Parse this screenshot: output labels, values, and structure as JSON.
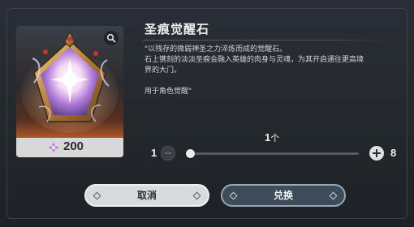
{
  "item": {
    "name": "圣痕觉醒石",
    "description": [
      "\"以残存的微弱神圣之力淬炼而成的觉醒石。",
      "石上镌刻的淡淡圣痕会融入英雄的肉身与灵魂，为其开启通往更高境",
      "界的大门。",
      "",
      "用于角色觉醒\""
    ],
    "price": "200",
    "price_icon": "purple-crystal-icon"
  },
  "quantity": {
    "current": "1",
    "unit": "个",
    "min": "1",
    "max": "8",
    "slider_fraction": 0
  },
  "buttons": {
    "cancel": "取消",
    "confirm": "兑换"
  },
  "colors": {
    "confirm_button": "#3c4c5a",
    "cancel_button": "#d9dadb",
    "card_glow": "#d9742f"
  }
}
